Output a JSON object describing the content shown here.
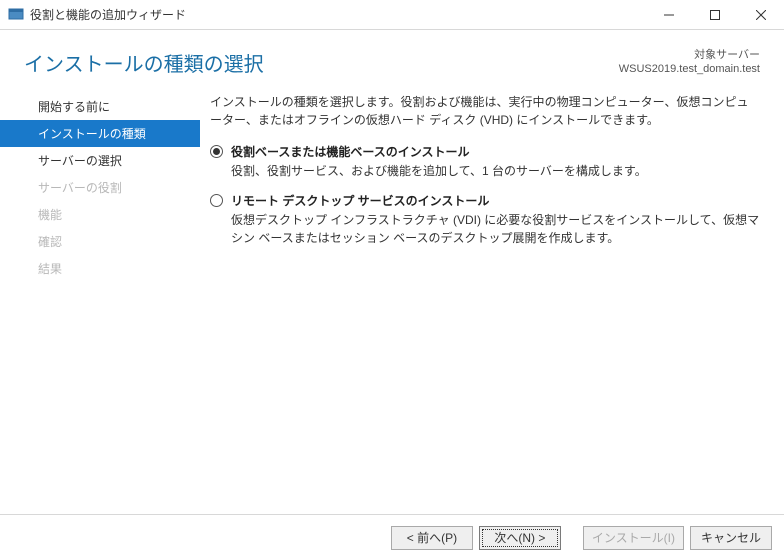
{
  "titlebar": {
    "title": "役割と機能の追加ウィザード"
  },
  "header": {
    "page_title": "インストールの種類の選択",
    "server_label": "対象サーバー",
    "server_name": "WSUS2019.test_domain.test"
  },
  "sidebar": {
    "items": [
      {
        "label": "開始する前に",
        "state": "normal"
      },
      {
        "label": "インストールの種類",
        "state": "selected"
      },
      {
        "label": "サーバーの選択",
        "state": "normal"
      },
      {
        "label": "サーバーの役割",
        "state": "disabled"
      },
      {
        "label": "機能",
        "state": "disabled"
      },
      {
        "label": "確認",
        "state": "disabled"
      },
      {
        "label": "結果",
        "state": "disabled"
      }
    ]
  },
  "main": {
    "intro": "インストールの種類を選択します。役割および機能は、実行中の物理コンピューター、仮想コンピューター、またはオフラインの仮想ハード ディスク (VHD) にインストールできます。",
    "options": [
      {
        "label": "役割ベースまたは機能ベースのインストール",
        "desc": "役割、役割サービス、および機能を追加して、1 台のサーバーを構成します。",
        "checked": true
      },
      {
        "label": "リモート デスクトップ サービスのインストール",
        "desc": "仮想デスクトップ インフラストラクチャ (VDI) に必要な役割サービスをインストールして、仮想マシン ベースまたはセッション ベースのデスクトップ展開を作成します。",
        "checked": false
      }
    ]
  },
  "footer": {
    "prev": "< 前へ(P)",
    "next": "次へ(N) >",
    "install": "インストール(I)",
    "cancel": "キャンセル"
  }
}
